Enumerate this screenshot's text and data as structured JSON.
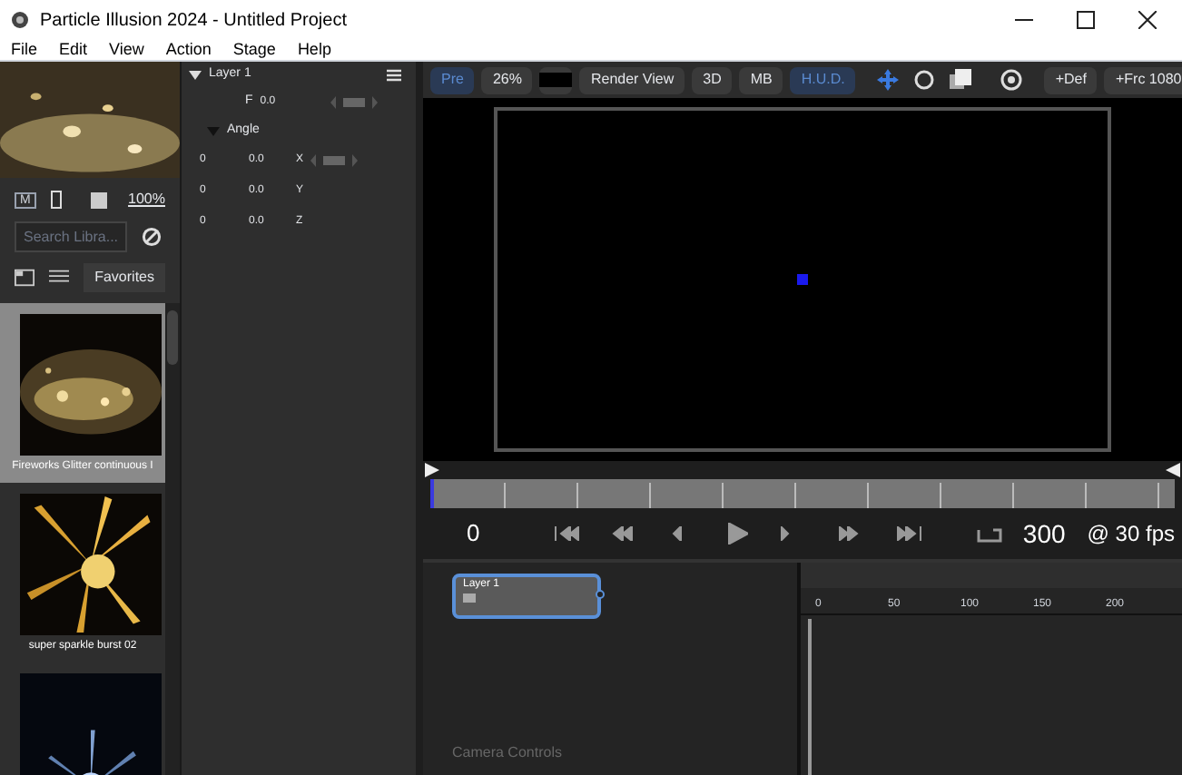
{
  "window": {
    "title": "Particle Illusion 2024 - Untitled Project"
  },
  "menu": [
    "File",
    "Edit",
    "View",
    "Action",
    "Stage",
    "Help"
  ],
  "library": {
    "m_button": "M",
    "zoom": "100%",
    "search": {
      "placeholder": "Search Libra..."
    },
    "tab": "Favorites",
    "items": [
      {
        "label": "Fireworks Glitter continuous I",
        "selected": true
      },
      {
        "label": "super sparkle burst 02",
        "selected": false
      },
      {
        "selected": false
      }
    ]
  },
  "properties": {
    "layer": "Layer 1",
    "expanded": true,
    "f_label": "F",
    "f_value": "0.0",
    "group": "Angle",
    "group_expanded": true,
    "rows": [
      {
        "a": "0",
        "b": "0.0",
        "axis": "X",
        "keyframe": true
      },
      {
        "a": "0",
        "b": "0.0",
        "axis": "Y",
        "keyframe": false
      },
      {
        "a": "0",
        "b": "0.0",
        "axis": "Z",
        "keyframe": false
      }
    ]
  },
  "toolbar": [
    {
      "label": "Pre",
      "kind": "toggle",
      "on": true
    },
    {
      "label": "26%",
      "kind": "dropdown"
    },
    {
      "kind": "swatch"
    },
    {
      "label": "Render View",
      "kind": "dropdown"
    },
    {
      "label": "3D",
      "kind": "toggle",
      "on": false
    },
    {
      "label": "MB",
      "kind": "toggle",
      "on": false
    },
    {
      "label": "H.U.D.",
      "kind": "toggle",
      "on": true
    },
    {
      "kind": "icons"
    },
    {
      "label": "+Def",
      "kind": "button"
    },
    {
      "label": "+Frc 1080",
      "kind": "button"
    }
  ],
  "transport": {
    "start": "0",
    "end": "300",
    "fps": "@ 30 fps"
  },
  "node": {
    "label": "Layer 1"
  },
  "timeline_ticks": [
    "0",
    "50",
    "100",
    "150",
    "200"
  ],
  "camera_label": "Camera Controls"
}
